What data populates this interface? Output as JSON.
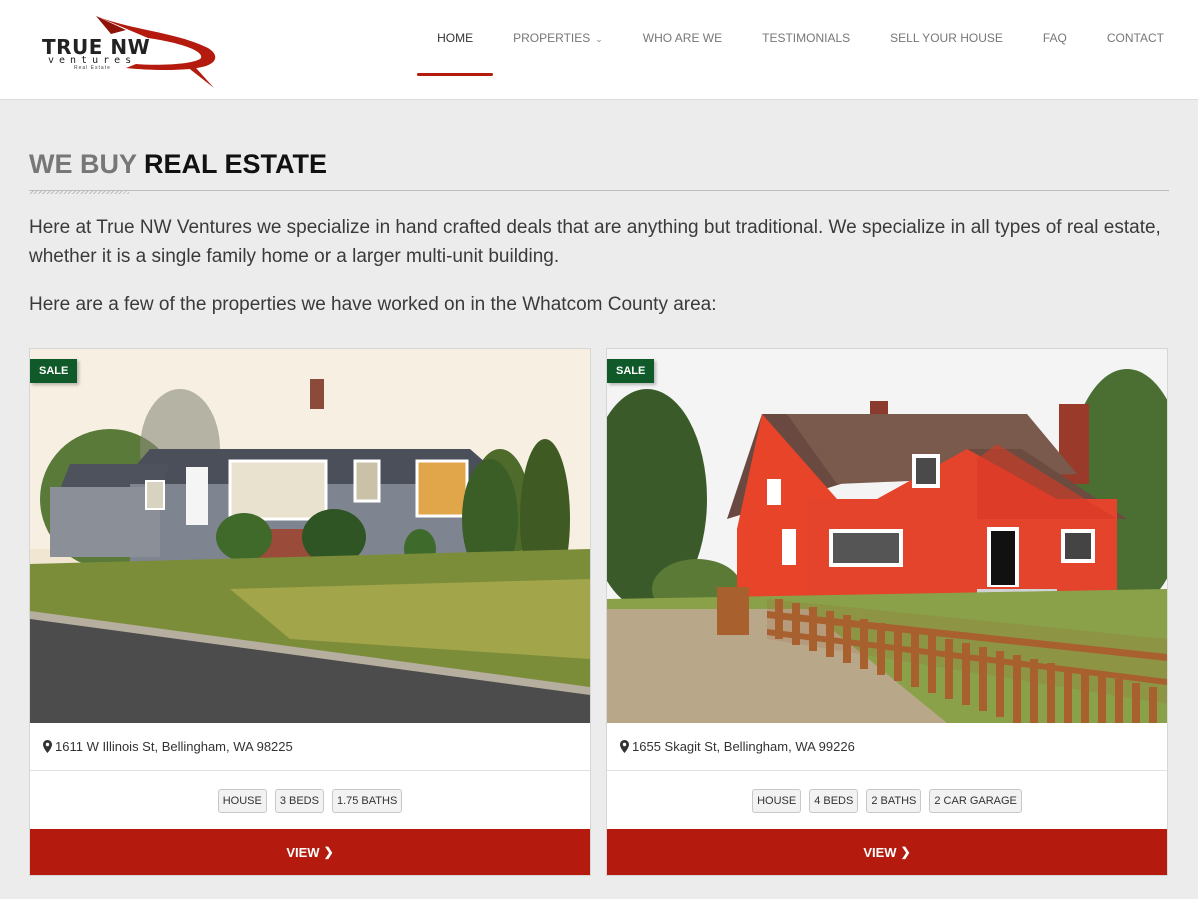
{
  "brand": {
    "name": "TRUE NW",
    "sub": "ventures",
    "tagline": "Real Estate"
  },
  "nav": [
    {
      "label": "HOME",
      "active": true
    },
    {
      "label": "PROPERTIES",
      "dropdown": true
    },
    {
      "label": "WHO ARE WE"
    },
    {
      "label": "TESTIMONIALS"
    },
    {
      "label": "SELL YOUR HOUSE"
    },
    {
      "label": "FAQ"
    },
    {
      "label": "CONTACT"
    }
  ],
  "page": {
    "title_light": "WE BUY",
    "title_bold": "REAL ESTATE",
    "intro": "Here at True NW Ventures we specialize in hand crafted deals that are anything but traditional. We specialize in all types of real estate, whether it is a single family home or a larger multi-unit building.",
    "sub": "Here are a few of the properties we have worked on in the Whatcom County area:"
  },
  "properties": [
    {
      "badge": "SALE",
      "address": "1611 W Illinois St, Bellingham, WA 98225",
      "tags": [
        "HOUSE",
        "3 BEDS",
        "1.75 BATHS"
      ],
      "view_label": "VIEW"
    },
    {
      "badge": "SALE",
      "address": "1655 Skagit St, Bellingham, WA 99226",
      "tags": [
        "HOUSE",
        "4 BEDS",
        "2 BATHS",
        "2 CAR GARAGE"
      ],
      "view_label": "VIEW"
    }
  ],
  "colors": {
    "accent": "#b41a0d",
    "badge": "#0f5a28"
  },
  "icons": {
    "address": "map-marker-icon",
    "view": "chevron-right-icon",
    "dropdown": "chevron-down-icon"
  }
}
